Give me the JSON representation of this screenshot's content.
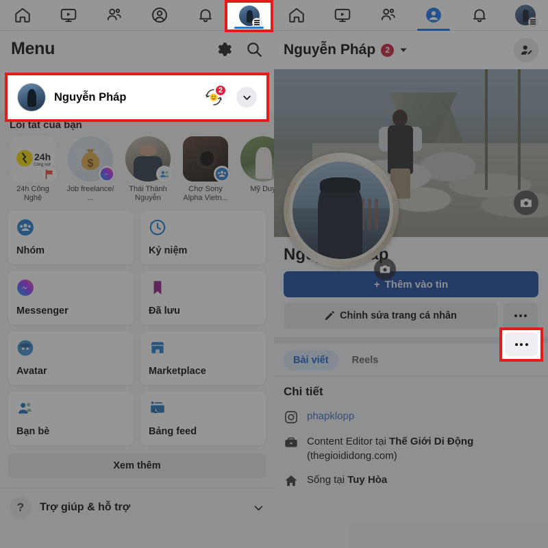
{
  "left": {
    "tabs": [
      {
        "name": "home",
        "icon": "home-icon",
        "active": false
      },
      {
        "name": "video",
        "icon": "video-icon",
        "active": false
      },
      {
        "name": "friends",
        "icon": "friends-icon",
        "active": false
      },
      {
        "name": "profile",
        "icon": "profile-circle-icon",
        "active": false
      },
      {
        "name": "notifications",
        "icon": "bell-icon",
        "active": false
      },
      {
        "name": "menu",
        "icon": "avatar-menu-icon",
        "active": true
      }
    ],
    "header": {
      "title": "Menu",
      "settings_icon": "gear-icon",
      "search_icon": "search-icon"
    },
    "profile_row": {
      "name": "Nguyễn Pháp",
      "badge_count": "2",
      "chevron_icon": "chevron-down-icon"
    },
    "shortcuts_label": "Lối tắt của bạn",
    "shortcuts": [
      {
        "label": "24h Công Nghệ",
        "badge": "page-flag-icon",
        "shape": "rsq"
      },
      {
        "label": "Job freelance/ ...",
        "badge": "messenger-icon",
        "shape": "round"
      },
      {
        "label": "Thái Thành Nguyễn",
        "badge": "group-icon",
        "shape": "round"
      },
      {
        "label": "Chợ Sony Alpha Vietn...",
        "badge": "group-icon",
        "shape": "rsq"
      },
      {
        "label": "Mỹ Duy",
        "badge": "",
        "shape": "round"
      }
    ],
    "tiles": [
      {
        "label": "Nhóm",
        "icon": "groups-icon"
      },
      {
        "label": "Kỷ niệm",
        "icon": "memories-clock-icon"
      },
      {
        "label": "Messenger",
        "icon": "messenger-icon"
      },
      {
        "label": "Đã lưu",
        "icon": "bookmark-icon"
      },
      {
        "label": "Avatar",
        "icon": "avatar-face-icon"
      },
      {
        "label": "Marketplace",
        "icon": "marketplace-store-icon"
      },
      {
        "label": "Bạn bè",
        "icon": "friends-icon"
      },
      {
        "label": "Bảng feed",
        "icon": "feed-board-icon"
      }
    ],
    "see_more": "Xem thêm",
    "help": {
      "label": "Trợ giúp & hỗ trợ",
      "icon": "question-mark-icon",
      "chevron_icon": "chevron-down-icon"
    }
  },
  "right": {
    "tabs": [
      {
        "name": "home",
        "icon": "home-icon",
        "active": false
      },
      {
        "name": "video",
        "icon": "video-icon",
        "active": false
      },
      {
        "name": "friends",
        "icon": "friends-icon",
        "active": false
      },
      {
        "name": "profile",
        "icon": "profile-circle-icon",
        "active": true
      },
      {
        "name": "notifications",
        "icon": "bell-icon",
        "active": false
      },
      {
        "name": "menu",
        "icon": "avatar-menu-icon",
        "active": false
      }
    ],
    "header": {
      "name": "Nguyễn Pháp",
      "badge_count": "2",
      "chevron_icon": "chevron-down-icon",
      "add_friend_icon": "add-friend-icon"
    },
    "cover_camera_icon": "camera-icon",
    "avatar_camera_icon": "camera-icon",
    "profile_name": "Nguyễn Pháp",
    "add_story_button": "Thêm vào tin",
    "add_story_plus": "+",
    "edit_profile_button": "Chỉnh sửa trang cá nhân",
    "edit_pencil_icon": "pencil-icon",
    "more_button_icon": "ellipsis-icon",
    "tabs_content": [
      {
        "label": "Bài viết",
        "active": true
      },
      {
        "label": "Reels",
        "active": false
      }
    ],
    "details_title": "Chi tiết",
    "details": [
      {
        "icon": "instagram-icon",
        "text": "phapklopp",
        "link": true
      },
      {
        "icon": "briefcase-icon",
        "text_plain": "Content Editor tại ",
        "text_bold": "Thế Giới Di Động",
        "text_plain2": " (thegioididong.com)",
        "link": false
      },
      {
        "icon": "home-house-icon",
        "text_plain": "Sống tại ",
        "text_bold": "Tuy Hòa",
        "text_plain2": "",
        "link": false
      }
    ]
  },
  "highlights": {
    "accent_color": "#e21b1b",
    "boxes": [
      "menu-tab-highlight",
      "profile-row-highlight",
      "more-button-highlight"
    ]
  }
}
